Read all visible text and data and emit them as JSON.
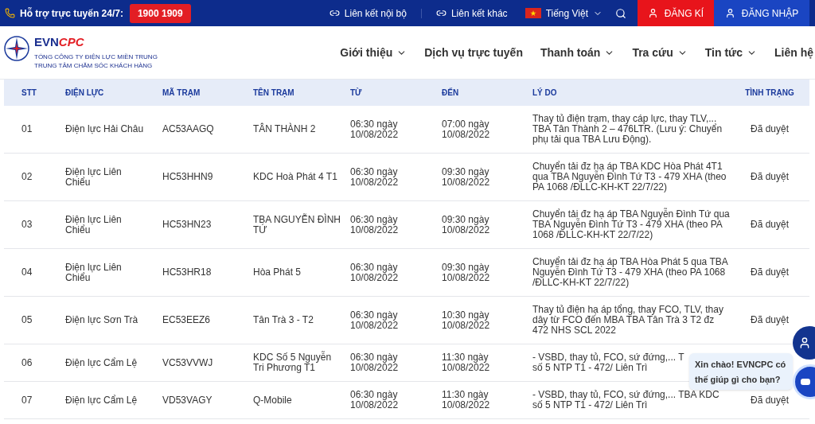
{
  "top_bar": {
    "support_label": "Hỗ trợ trực tuyến 24/7:",
    "hotline": "1900 1909",
    "links": [
      "Liên kết nội bộ",
      "Liên kết khác"
    ],
    "language": "Tiếng Việt",
    "register": "ĐĂNG KÍ",
    "login": "ĐĂNG NHẬP"
  },
  "header": {
    "logo": {
      "brand_a": "EVN",
      "brand_b": "CPC",
      "line_1": "TỔNG CÔNG TY ĐIỆN LỰC MIỀN TRUNG",
      "line_2": "TRUNG TÂM CHĂM SÓC KHÁCH HÀNG"
    },
    "nav": [
      {
        "label": "Giới thiệu",
        "has_menu": true
      },
      {
        "label": "Dịch vụ trực tuyến",
        "has_menu": false
      },
      {
        "label": "Thanh toán",
        "has_menu": true
      },
      {
        "label": "Tra cứu",
        "has_menu": true
      },
      {
        "label": "Tin tức",
        "has_menu": true
      },
      {
        "label": "Liên hệ",
        "has_menu": false
      }
    ]
  },
  "table": {
    "columns": [
      "STT",
      "ĐIỆN LỰC",
      "MÃ TRẠM",
      "TÊN TRẠM",
      "TỪ",
      "ĐẾN",
      "LÝ DO",
      "TÌNH TRẠNG"
    ],
    "rows": [
      {
        "stt": "01",
        "unit": "Điện lực Hải Châu",
        "code": "AC53AAGQ",
        "station": "TÂN THÀNH 2",
        "from": "06:30 ngày 10/08/2022",
        "to": "07:00 ngày 10/08/2022",
        "reason": "Thay tủ điện trạm, thay cáp lực, thay TLV,... TBA Tân Thành 2 – 476LTR. (Lưu ý: Chuyển phụ tải qua TBA Lưu Động).",
        "status": "Đã duyệt"
      },
      {
        "stt": "02",
        "unit": "Điện lực Liên Chiểu",
        "code": "HC53HHN9",
        "station": "KDC Hoà Phát 4 T1",
        "from": "06:30 ngày 10/08/2022",
        "to": "09:30 ngày 10/08/2022",
        "reason": "Chuyển tải đz hạ áp TBA KDC Hòa Phát 4T1 qua TBA Nguyễn Đình Tứ T3 - 479 XHA (theo PA 1068 /ĐLLC-KH-KT 22/7/22)",
        "status": "Đã duyệt"
      },
      {
        "stt": "03",
        "unit": "Điện lực Liên Chiểu",
        "code": "HC53HN23",
        "station": "TBA NGUYỄN ĐÌNH TỨ",
        "from": "06:30 ngày 10/08/2022",
        "to": "09:30 ngày 10/08/2022",
        "reason": "Chuyển tải đz hạ áp TBA Nguyễn Đình Tứ qua TBA Nguyễn Đình Tứ T3 - 479 XHA (theo PA 1068 /ĐLLC-KH-KT 22/7/22)",
        "status": "Đã duyệt"
      },
      {
        "stt": "04",
        "unit": "Điện lực Liên Chiểu",
        "code": "HC53HR18",
        "station": "Hòa Phát 5",
        "from": "06:30 ngày 10/08/2022",
        "to": "09:30 ngày 10/08/2022",
        "reason": "Chuyển tải đz hạ áp TBA Hòa Phát 5 qua TBA Nguyễn Đình Tứ T3 - 479 XHA (theo PA 1068 /ĐLLC-KH-KT 22/7/22)",
        "status": "Đã duyệt"
      },
      {
        "stt": "05",
        "unit": "Điện lực Sơn Trà",
        "code": "EC53EEZ6",
        "station": "Tân Trà 3 - T2",
        "from": "06:30 ngày 10/08/2022",
        "to": "10:30 ngày 10/08/2022",
        "reason": "Thay tủ điện hạ áp tổng, thay FCO, TLV, thay dây từ FCO đến MBA TBA Tân Trà 3 T2 đz 472 NHS SCL 2022",
        "status": "Đã duyệt"
      },
      {
        "stt": "06",
        "unit": "Điện lực Cẩm Lệ",
        "code": "VC53VVWJ",
        "station": "KDC Số 5 Nguyễn Tri Phương T1",
        "from": "06:30 ngày 10/08/2022",
        "to": "11:30 ngày 10/08/2022",
        "reason": "- VSBD, thay tủ, FCO, sứ đứng,... T\nsố 5 NTP T1 - 472/ Liên Trì"
      },
      {
        "stt": "07",
        "unit": "Điện lực Cẩm Lệ",
        "code": "VD53VAGY",
        "station": "Q-Mobile",
        "from": "06:30 ngày 10/08/2022",
        "to": "11:30 ngày 10/08/2022",
        "reason": "- VSBD, thay tủ, FCO, sứ đứng,... TBA KDC số 5 NTP T1 - 472/ Liên Trì",
        "status": "Đã duyệt"
      }
    ]
  },
  "chat": {
    "greeting": "Xin chào! EVNCPC có thế giúp gì cho bạn?"
  }
}
